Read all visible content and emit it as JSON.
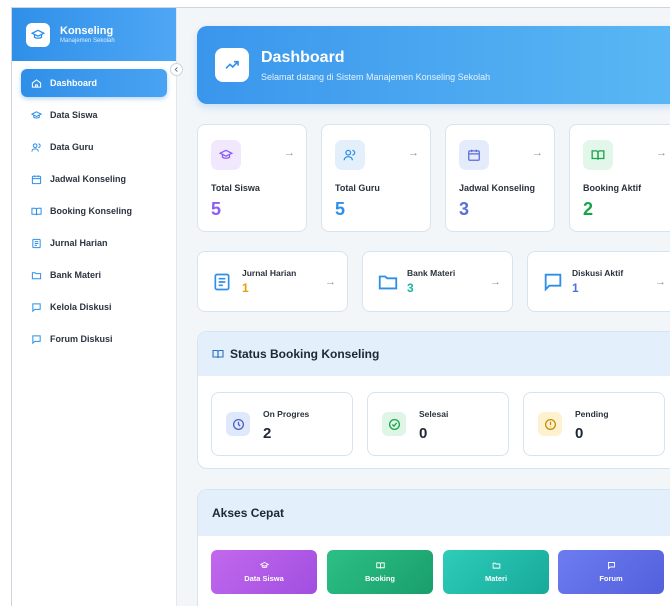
{
  "brand": {
    "title": "Konseling",
    "subtitle": "Manajemen Sekolah"
  },
  "sidebar": {
    "items": [
      {
        "label": "Dashboard",
        "icon": "home-icon",
        "active": true
      },
      {
        "label": "Data Siswa",
        "icon": "graduation-cap-icon"
      },
      {
        "label": "Data Guru",
        "icon": "users-icon"
      },
      {
        "label": "Jadwal Konseling",
        "icon": "calendar-icon"
      },
      {
        "label": "Booking Konseling",
        "icon": "book-open-icon"
      },
      {
        "label": "Jurnal Harian",
        "icon": "journal-icon"
      },
      {
        "label": "Bank Materi",
        "icon": "folder-icon"
      },
      {
        "label": "Kelola Diskusi",
        "icon": "chat-icon"
      },
      {
        "label": "Forum Diskusi",
        "icon": "chat-icon"
      }
    ]
  },
  "hero": {
    "title": "Dashboard",
    "subtitle": "Selamat datang di Sistem Manajemen Konseling Sekolah"
  },
  "stats": [
    {
      "label": "Total Siswa",
      "value": "5",
      "color": "#8b5cf6"
    },
    {
      "label": "Total Guru",
      "value": "5",
      "color": "#2f8fe8"
    },
    {
      "label": "Jadwal Konseling",
      "value": "3",
      "color": "#5b6fd6"
    },
    {
      "label": "Booking Aktif",
      "value": "2",
      "color": "#16a34a"
    }
  ],
  "wide_stats": [
    {
      "label": "Jurnal Harian",
      "value": "1",
      "color": "#e0a10a"
    },
    {
      "label": "Bank Materi",
      "value": "3",
      "color": "#14b8a6"
    },
    {
      "label": "Diskusi Aktif",
      "value": "1",
      "color": "#4f6fe0"
    }
  ],
  "booking_status": {
    "title": "Status Booking Konseling",
    "items": [
      {
        "label": "On Progres",
        "value": "2"
      },
      {
        "label": "Selesai",
        "value": "0"
      },
      {
        "label": "Pending",
        "value": "0"
      }
    ]
  },
  "quick_access": {
    "title": "Akses Cepat",
    "buttons": [
      {
        "label": "Data Siswa",
        "color": "#b058e8"
      },
      {
        "label": "Booking",
        "color": "#22b07a"
      },
      {
        "label": "Materi",
        "color": "#1fbfae"
      },
      {
        "label": "Forum",
        "color": "#5f6fe6"
      }
    ]
  }
}
